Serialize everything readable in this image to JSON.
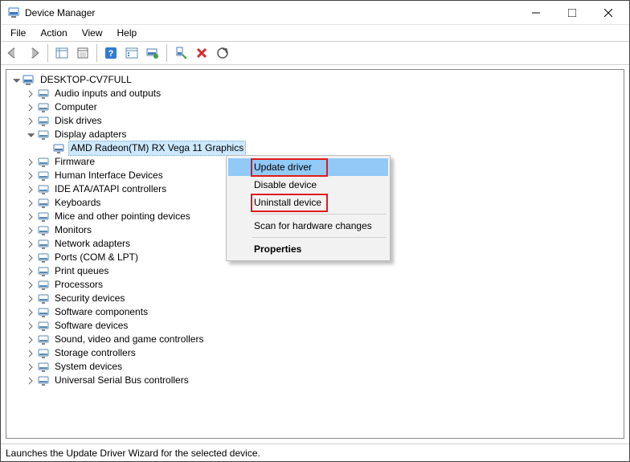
{
  "window": {
    "title": "Device Manager"
  },
  "menu": {
    "items": [
      "File",
      "Action",
      "View",
      "Help"
    ]
  },
  "toolbar": {
    "back": "Back",
    "forward": "Forward",
    "show_hide_tree": "Show/Hide Console Tree",
    "properties": "Properties",
    "help": "Help",
    "prop_sheet": "Property Sheet",
    "update_driver": "Update Driver Software",
    "uninstall": "Uninstall device",
    "scan": "Scan for hardware changes",
    "extra": ""
  },
  "tree": {
    "root": "DESKTOP-CV7FULL",
    "categories": [
      {
        "label": "Audio inputs and outputs",
        "expanded": false
      },
      {
        "label": "Computer",
        "expanded": false
      },
      {
        "label": "Disk drives",
        "expanded": false
      },
      {
        "label": "Display adapters",
        "expanded": true,
        "children": [
          {
            "label": "AMD Radeon(TM) RX Vega 11 Graphics",
            "selected": true
          }
        ]
      },
      {
        "label": "Firmware",
        "expanded": false
      },
      {
        "label": "Human Interface Devices",
        "expanded": false
      },
      {
        "label": "IDE ATA/ATAPI controllers",
        "expanded": false
      },
      {
        "label": "Keyboards",
        "expanded": false
      },
      {
        "label": "Mice and other pointing devices",
        "expanded": false
      },
      {
        "label": "Monitors",
        "expanded": false
      },
      {
        "label": "Network adapters",
        "expanded": false
      },
      {
        "label": "Ports (COM & LPT)",
        "expanded": false
      },
      {
        "label": "Print queues",
        "expanded": false
      },
      {
        "label": "Processors",
        "expanded": false
      },
      {
        "label": "Security devices",
        "expanded": false
      },
      {
        "label": "Software components",
        "expanded": false
      },
      {
        "label": "Software devices",
        "expanded": false
      },
      {
        "label": "Sound, video and game controllers",
        "expanded": false
      },
      {
        "label": "Storage controllers",
        "expanded": false
      },
      {
        "label": "System devices",
        "expanded": false
      },
      {
        "label": "Universal Serial Bus controllers",
        "expanded": false
      }
    ]
  },
  "context_menu": {
    "items": [
      {
        "label": "Update driver",
        "highlighted": true,
        "redbox": true
      },
      {
        "label": "Disable device"
      },
      {
        "label": "Uninstall device",
        "redbox": true
      },
      {
        "sep": true
      },
      {
        "label": "Scan for hardware changes"
      },
      {
        "sep": true
      },
      {
        "label": "Properties",
        "default": true
      }
    ]
  },
  "status_bar": {
    "text": "Launches the Update Driver Wizard for the selected device."
  }
}
